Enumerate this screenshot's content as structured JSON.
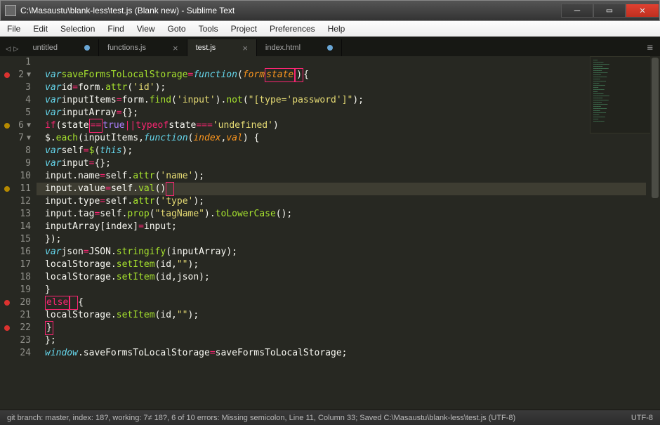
{
  "window": {
    "title": "C:\\Masaustu\\blank-less\\test.js (Blank new) - Sublime Text"
  },
  "menu": [
    "File",
    "Edit",
    "Selection",
    "Find",
    "View",
    "Goto",
    "Tools",
    "Project",
    "Preferences",
    "Help"
  ],
  "tabs": [
    {
      "label": "untitled",
      "dirty": true,
      "active": false
    },
    {
      "label": "functions.js",
      "dirty": false,
      "active": false
    },
    {
      "label": "test.js",
      "dirty": false,
      "active": true
    },
    {
      "label": "index.html",
      "dirty": true,
      "active": false
    }
  ],
  "editor": {
    "current_line": 11,
    "lines": [
      {
        "n": 1,
        "mark": null,
        "fold": false,
        "html": ""
      },
      {
        "n": 2,
        "mark": "red",
        "fold": true,
        "html": "<span class='st'>var</span> <span class='fn'>saveFormsToLocalStorage</span> <span class='op'>=</span> <span class='st'>function</span><span class='pu'>(</span><span class='pr'>form</span> <span class='pr err-box'>state</span><span class='pu err-box'>)</span><span class='pu'>{</span>"
      },
      {
        "n": 3,
        "mark": null,
        "fold": false,
        "html": "  <span class='st'>var</span> <span class='id'>id</span> <span class='op'>=</span> <span class='id'>form</span><span class='pu'>.</span><span class='fn'>attr</span><span class='pu'>(</span><span class='str'>'id'</span><span class='pu'>);</span>"
      },
      {
        "n": 4,
        "mark": null,
        "fold": false,
        "html": "  <span class='st'>var</span> <span class='id'>inputItems</span> <span class='op'>=</span> <span class='id'>form</span><span class='pu'>.</span><span class='fn'>find</span><span class='pu'>(</span><span class='str'>'input'</span><span class='pu'>).</span><span class='fn'>not</span><span class='pu'>(</span><span class='str'>\"[type='password']\"</span><span class='pu'>);</span>"
      },
      {
        "n": 5,
        "mark": null,
        "fold": false,
        "html": "  <span class='st'>var</span> <span class='id'>inputArray</span> <span class='op'>=</span> <span class='pu'>{}</span><span class='pu'>;</span>"
      },
      {
        "n": 6,
        "mark": "yellow",
        "fold": true,
        "html": "  <span class='kw2'>if</span> <span class='pu'>(</span><span class='id'>state</span> <span class='op err-box'>==</span> <span class='num'>true</span> <span class='op'>||</span> <span class='kw2'>typeof</span> <span class='id'>state</span> <span class='op'>===</span> <span class='str'>'undefined'</span><span class='pu'>)</span>"
      },
      {
        "n": 7,
        "mark": null,
        "fold": true,
        "html": "    <span class='id'>$</span><span class='pu'>.</span><span class='fn'>each</span><span class='pu'>(</span><span class='id'>inputItems</span><span class='pu'>,</span> <span class='st'>function</span><span class='pu'>(</span><span class='pr'>index</span><span class='pu'>,</span> <span class='pr'>val</span><span class='pu'>) {</span>"
      },
      {
        "n": 8,
        "mark": null,
        "fold": false,
        "html": "      <span class='st'>var</span> <span class='id'>self</span> <span class='op'>=</span> <span class='fn'>$</span><span class='pu'>(</span><span class='st'>this</span><span class='pu'>);</span>"
      },
      {
        "n": 9,
        "mark": null,
        "fold": false,
        "html": "      <span class='st'>var</span> <span class='id'>input</span> <span class='op'>=</span> <span class='pu'>{}</span><span class='pu'>;</span>"
      },
      {
        "n": 10,
        "mark": null,
        "fold": false,
        "html": "      <span class='id'>input</span><span class='pu'>.</span><span class='id'>name</span> <span class='op'>=</span> <span class='id'>self</span><span class='pu'>.</span><span class='fn'>attr</span><span class='pu'>(</span><span class='str'>'name'</span><span class='pu'>);</span>"
      },
      {
        "n": 11,
        "mark": "yellow",
        "fold": false,
        "html": "      <span class='id'>input</span><span class='pu'>.</span><span class='id'>value</span> <span class='op'>=</span> <span class='id'>self</span><span class='pu'>.</span><span class='fn'>val</span><span class='pu'>()</span><span class='pu err-box'>&nbsp;</span>"
      },
      {
        "n": 12,
        "mark": null,
        "fold": false,
        "html": "      <span class='id'>input</span><span class='pu'>.</span><span class='id'>type</span> <span class='op'>=</span> <span class='id'>self</span><span class='pu'>.</span><span class='fn'>attr</span><span class='pu'>(</span><span class='str'>'type'</span><span class='pu'>);</span>"
      },
      {
        "n": 13,
        "mark": null,
        "fold": false,
        "html": "      <span class='id'>input</span><span class='pu'>.</span><span class='id'>tag</span> <span class='op'>=</span> <span class='id'>self</span><span class='pu'>.</span><span class='fn'>prop</span><span class='pu'>(</span><span class='str'>\"tagName\"</span><span class='pu'>).</span><span class='fn'>toLowerCase</span><span class='pu'>();</span>"
      },
      {
        "n": 14,
        "mark": null,
        "fold": false,
        "html": "      <span class='id'>inputArray</span><span class='pu'>[</span><span class='id'>index</span><span class='pu'>]</span> <span class='op'>=</span> <span class='id'>input</span><span class='pu'>;</span>"
      },
      {
        "n": 15,
        "mark": null,
        "fold": false,
        "html": "    <span class='pu'>});</span>"
      },
      {
        "n": 16,
        "mark": null,
        "fold": false,
        "html": "    <span class='st'>var</span> <span class='id'>json</span> <span class='op'>=</span> <span class='id'>JSON</span><span class='pu'>.</span><span class='fn'>stringify</span><span class='pu'>(</span><span class='id'>inputArray</span><span class='pu'>);</span>"
      },
      {
        "n": 17,
        "mark": null,
        "fold": false,
        "html": "    <span class='id'>localStorage</span><span class='pu'>.</span><span class='fn'>setItem</span><span class='pu'>(</span><span class='id'>id</span> <span class='pu'>,</span> <span class='str'>\"\"</span><span class='pu'>);</span>"
      },
      {
        "n": 18,
        "mark": null,
        "fold": false,
        "html": "    <span class='id'>localStorage</span><span class='pu'>.</span><span class='fn'>setItem</span><span class='pu'>(</span><span class='id'>id</span> <span class='pu'>,</span> <span class='id'>json</span><span class='pu'>);</span>"
      },
      {
        "n": 19,
        "mark": null,
        "fold": false,
        "html": "  <span class='pu'>}</span>"
      },
      {
        "n": 20,
        "mark": "red",
        "fold": false,
        "html": "  <span class='err-red'>else</span><span class='pu err-box'>&nbsp;</span><span class='pu'>{</span>"
      },
      {
        "n": 21,
        "mark": null,
        "fold": false,
        "html": "    <span class='id'>localStorage</span><span class='pu'>.</span><span class='fn'>setItem</span><span class='pu'>(</span><span class='id'>id</span> <span class='pu'>,</span> <span class='str'>\"\"</span><span class='pu'>);</span>"
      },
      {
        "n": 22,
        "mark": "red",
        "fold": false,
        "html": "  <span class='pu err-box'>}</span>"
      },
      {
        "n": 23,
        "mark": null,
        "fold": false,
        "html": "<span class='pu'>};</span>"
      },
      {
        "n": 24,
        "mark": null,
        "fold": false,
        "html": "<span class='st'>window</span><span class='pu'>.</span><span class='id'>saveFormsToLocalStorage</span> <span class='op'>=</span> <span class='id'>saveFormsToLocalStorage</span><span class='pu'>;</span>"
      }
    ]
  },
  "status": {
    "left": "git branch: master, index: 18?, working: 7≠ 18?, 6 of 10 errors: Missing semicolon, Line 11, Column 33; Saved C:\\Masaustu\\blank-less\\test.js (UTF-8)",
    "right": "UTF-8"
  }
}
